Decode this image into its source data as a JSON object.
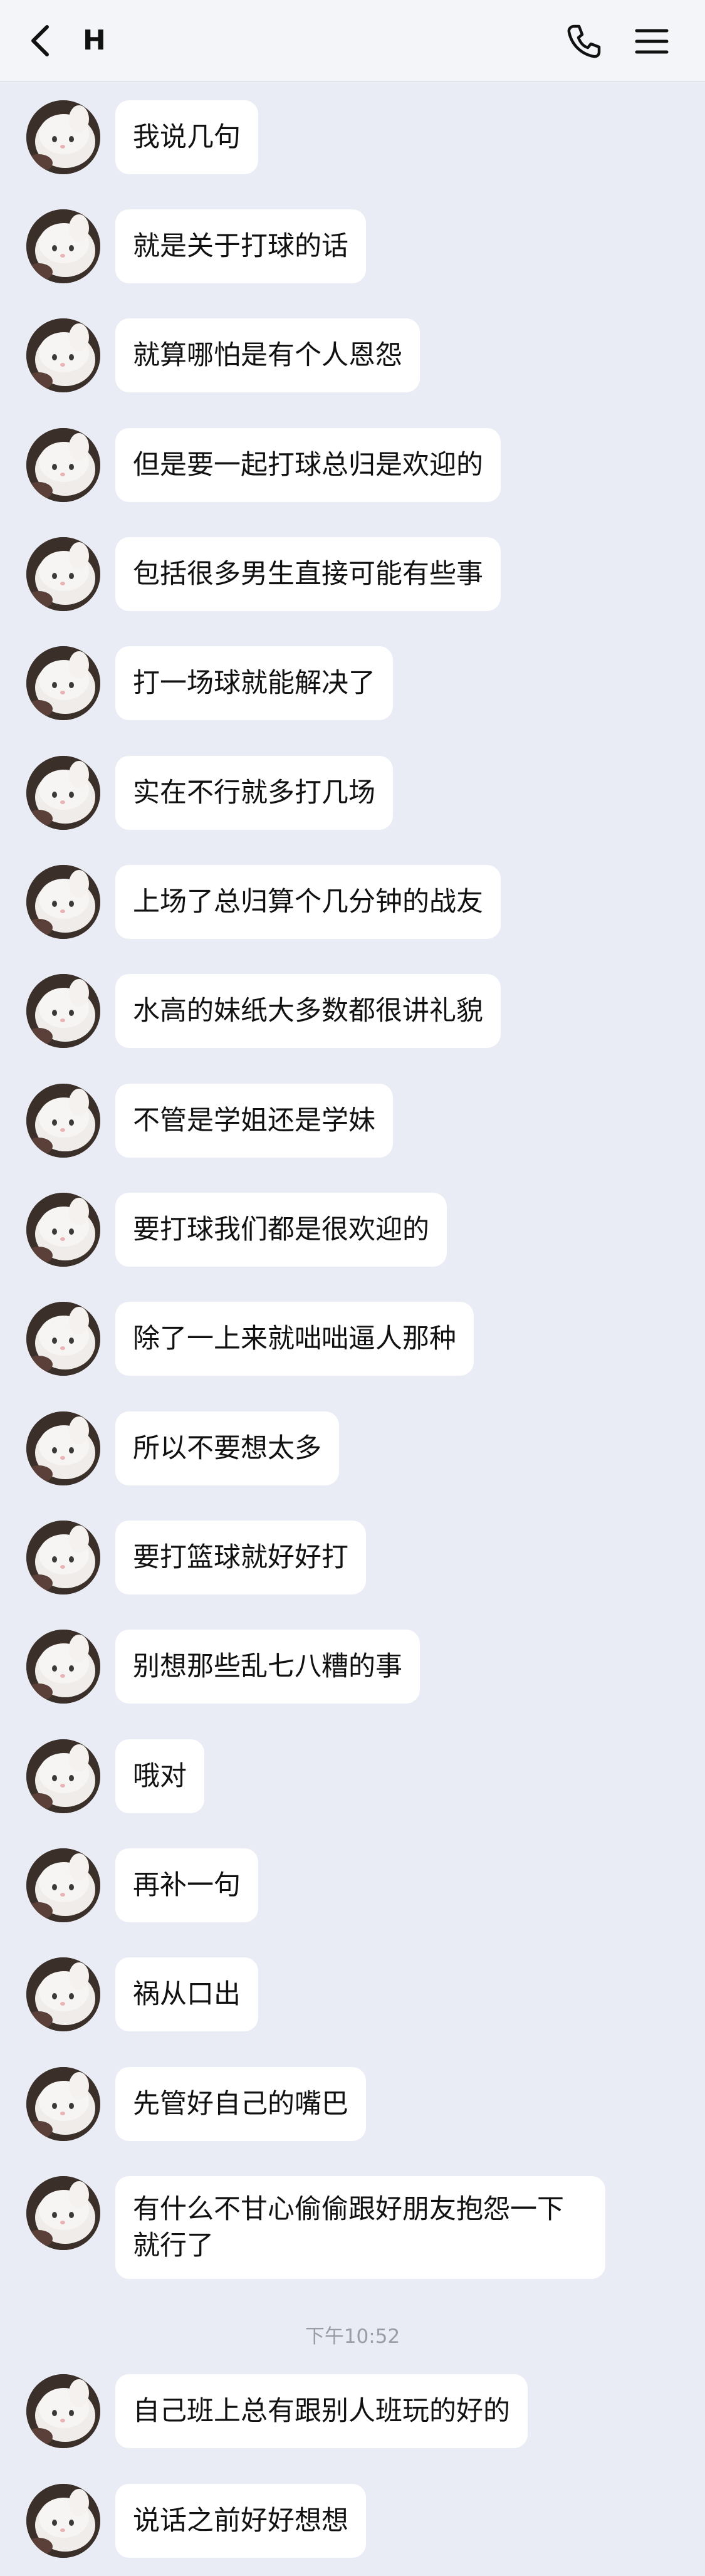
{
  "header": {
    "title": "H"
  },
  "messages": [
    "我说几句",
    "就是关于打球的话",
    "就算哪怕是有个人恩怨",
    "但是要一起打球总归是欢迎的",
    "包括很多男生直接可能有些事",
    "打一场球就能解决了",
    "实在不行就多打几场",
    "上场了总归算个几分钟的战友",
    "水高的妹纸大多数都很讲礼貌",
    "不管是学姐还是学妹",
    "要打球我们都是很欢迎的",
    "除了一上来就咄咄逼人那种",
    "所以不要想太多",
    "要打篮球就好好打",
    "别想那些乱七八糟的事",
    "哦对",
    "再补一句",
    "祸从口出",
    "先管好自己的嘴巴",
    "有什么不甘心偷偷跟好朋友抱怨一下就行了",
    "自己班上总有跟别人班玩的好的",
    "说话之前好好想想"
  ],
  "timestamp": "下午10:52",
  "icons": {
    "back": "chevron-left-icon",
    "call": "phone-icon",
    "menu": "menu-icon"
  }
}
